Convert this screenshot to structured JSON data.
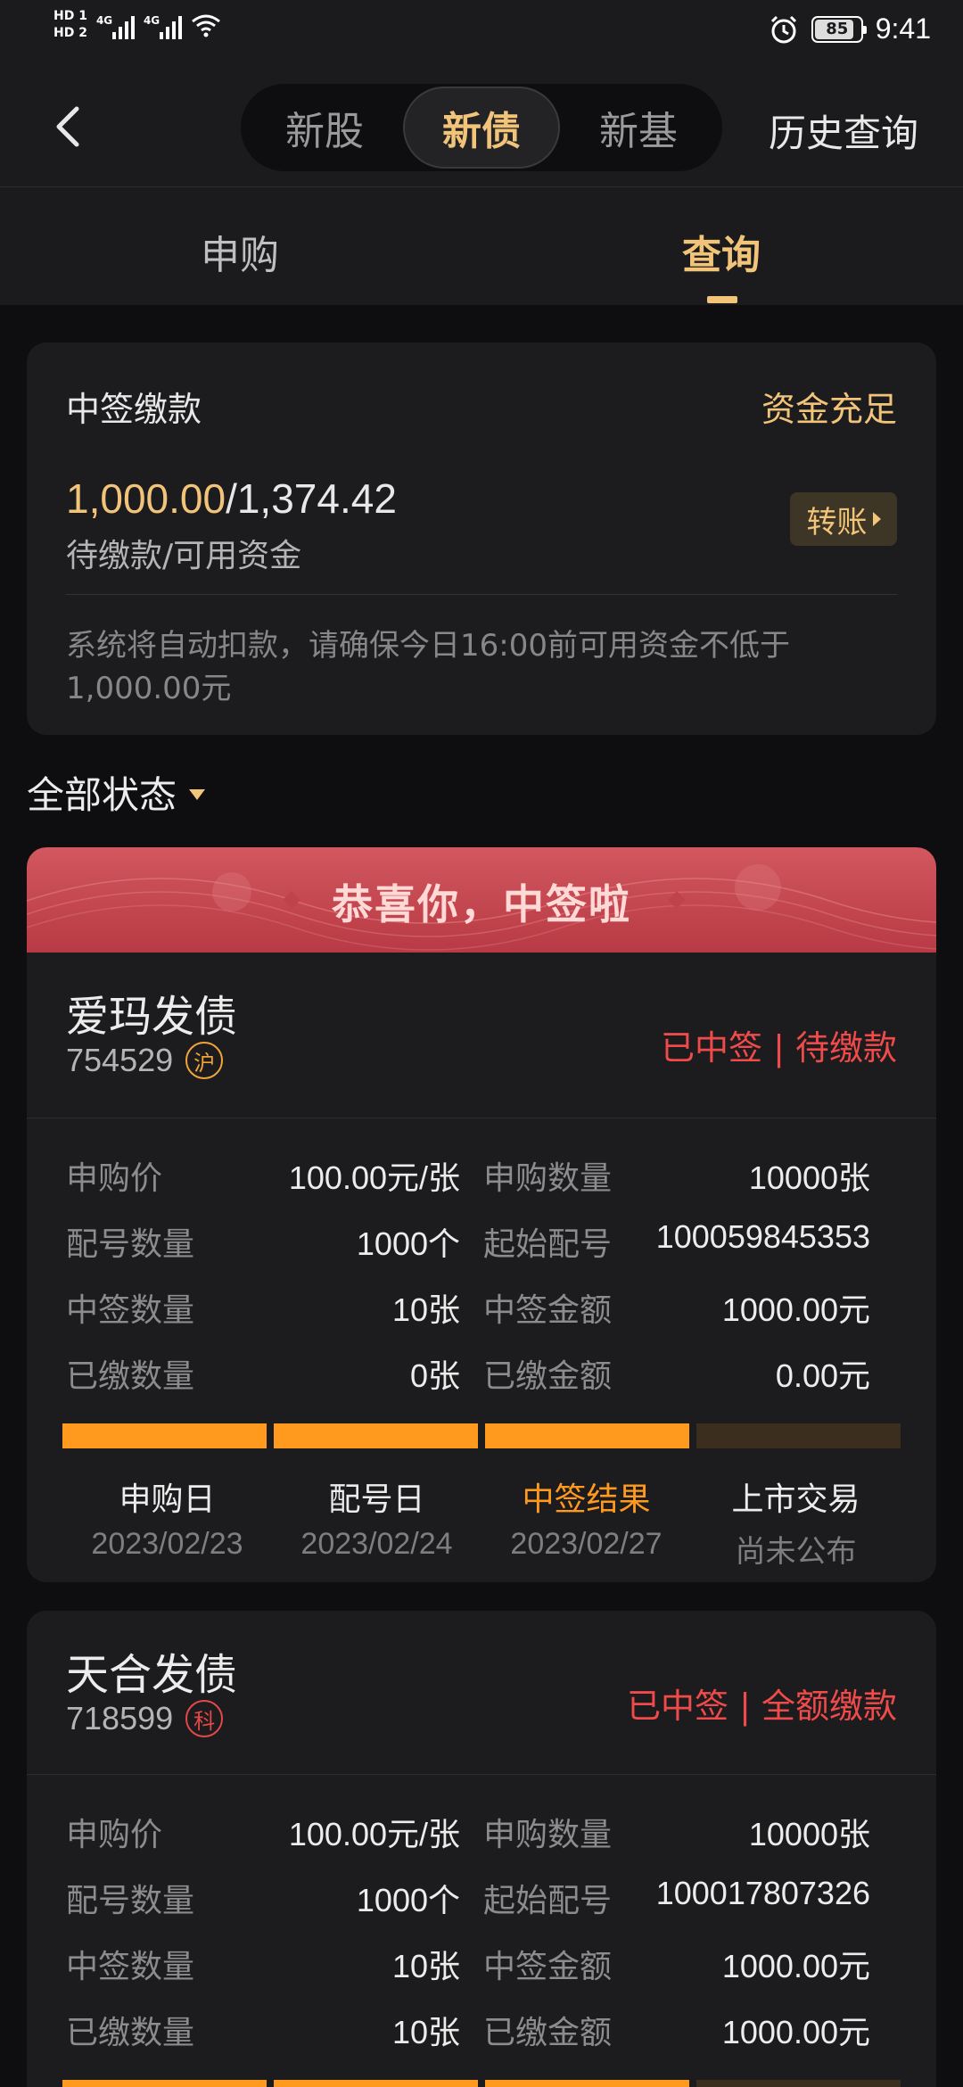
{
  "status_bar": {
    "hd1": "HD 1",
    "hd2": "HD 2",
    "net1": "4G",
    "net2": "4G",
    "battery": "85",
    "time": "9:41"
  },
  "nav": {
    "back_icon": "chevron-left-icon",
    "segments": [
      "新股",
      "新债",
      "新基"
    ],
    "active_segment": "新债",
    "history": "历史查询"
  },
  "subtabs": {
    "items": [
      "申购",
      "查询"
    ],
    "active": "查询"
  },
  "payment": {
    "title": "中签缴款",
    "status": "资金充足",
    "due_amount": "1,000.00",
    "available": "1,374.42",
    "sub_label": "待缴款/可用资金",
    "transfer_label": "转账",
    "note": "系统将自动扣款，请确保今日16:00前可用资金不低于1,000.00元"
  },
  "filter": {
    "label": "全部状态"
  },
  "bonds": [
    {
      "banner": "恭喜你，中签啦",
      "name": "爱玛发债",
      "code": "754529",
      "exchange": "沪",
      "status": "已中签 | 待缴款",
      "rows": [
        {
          "l1": "申购价",
          "v1": "100.00元/张",
          "l2": "申购数量",
          "v2": "10000张"
        },
        {
          "l1": "配号数量",
          "v1": "1000个",
          "l2": "起始配号",
          "v2": "100059845353"
        },
        {
          "l1": "中签数量",
          "v1": "10张",
          "l2": "中签金额",
          "v2": "1000.00元"
        },
        {
          "l1": "已缴数量",
          "v1": "0张",
          "l2": "已缴金额",
          "v2": "0.00元"
        }
      ],
      "progress_done": 3,
      "progress_total": 4,
      "steps": [
        {
          "name": "申购日",
          "date": "2023/02/23"
        },
        {
          "name": "配号日",
          "date": "2023/02/24"
        },
        {
          "name": "中签结果",
          "date": "2023/02/27"
        },
        {
          "name": "上市交易",
          "date": "尚未公布"
        }
      ],
      "current_step": 2
    },
    {
      "name": "天合发债",
      "code": "718599",
      "exchange": "科",
      "status": "已中签 | 全额缴款",
      "rows": [
        {
          "l1": "申购价",
          "v1": "100.00元/张",
          "l2": "申购数量",
          "v2": "10000张"
        },
        {
          "l1": "配号数量",
          "v1": "1000个",
          "l2": "起始配号",
          "v2": "100017807326"
        },
        {
          "l1": "中签数量",
          "v1": "10张",
          "l2": "中签金额",
          "v2": "1000.00元"
        },
        {
          "l1": "已缴数量",
          "v1": "10张",
          "l2": "已缴金额",
          "v2": "1000.00元"
        }
      ]
    }
  ],
  "colors": {
    "accent": "#f2c47a",
    "danger": "#f04a4a",
    "progress": "#ff9a1f",
    "background": "#0e0e10",
    "card": "#1c1c1e"
  }
}
